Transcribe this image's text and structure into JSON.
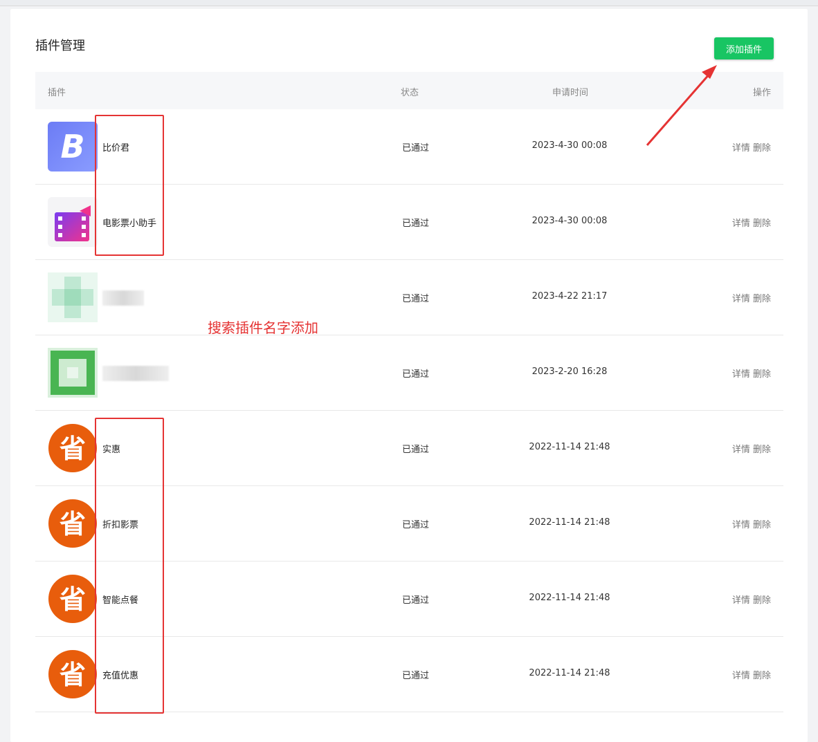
{
  "page": {
    "title": "插件管理",
    "add_button": "添加插件",
    "colors": {
      "accent": "#18c563",
      "annotation": "#e53333"
    }
  },
  "table": {
    "headers": [
      "插件",
      "状态",
      "申请时间",
      "操作"
    ],
    "ops": {
      "detail": "详情",
      "delete": "删除"
    },
    "rows": [
      {
        "name": "比价君",
        "status": "已通过",
        "time": "2023-4-30 00:08",
        "icon": "b-logo-icon"
      },
      {
        "name": "电影票小助手",
        "status": "已通过",
        "time": "2023-4-30 00:08",
        "icon": "film-icon"
      },
      {
        "name": "",
        "status": "已通过",
        "time": "2023-4-22 21:17",
        "icon": "blurred-icon"
      },
      {
        "name": "",
        "status": "已通过",
        "time": "2023-2-20 16:28",
        "icon": "blurred-icon"
      },
      {
        "name": "实惠",
        "status": "已通过",
        "time": "2022-11-14 21:48",
        "icon": "sheng-logo-icon"
      },
      {
        "name": "折扣影票",
        "status": "已通过",
        "time": "2022-11-14 21:48",
        "icon": "sheng-logo-icon"
      },
      {
        "name": "智能点餐",
        "status": "已通过",
        "time": "2022-11-14 21:48",
        "icon": "sheng-logo-icon"
      },
      {
        "name": "充值优惠",
        "status": "已通过",
        "time": "2022-11-14 21:48",
        "icon": "sheng-logo-icon"
      }
    ]
  },
  "annotation": {
    "text": "搜索插件名字添加"
  }
}
